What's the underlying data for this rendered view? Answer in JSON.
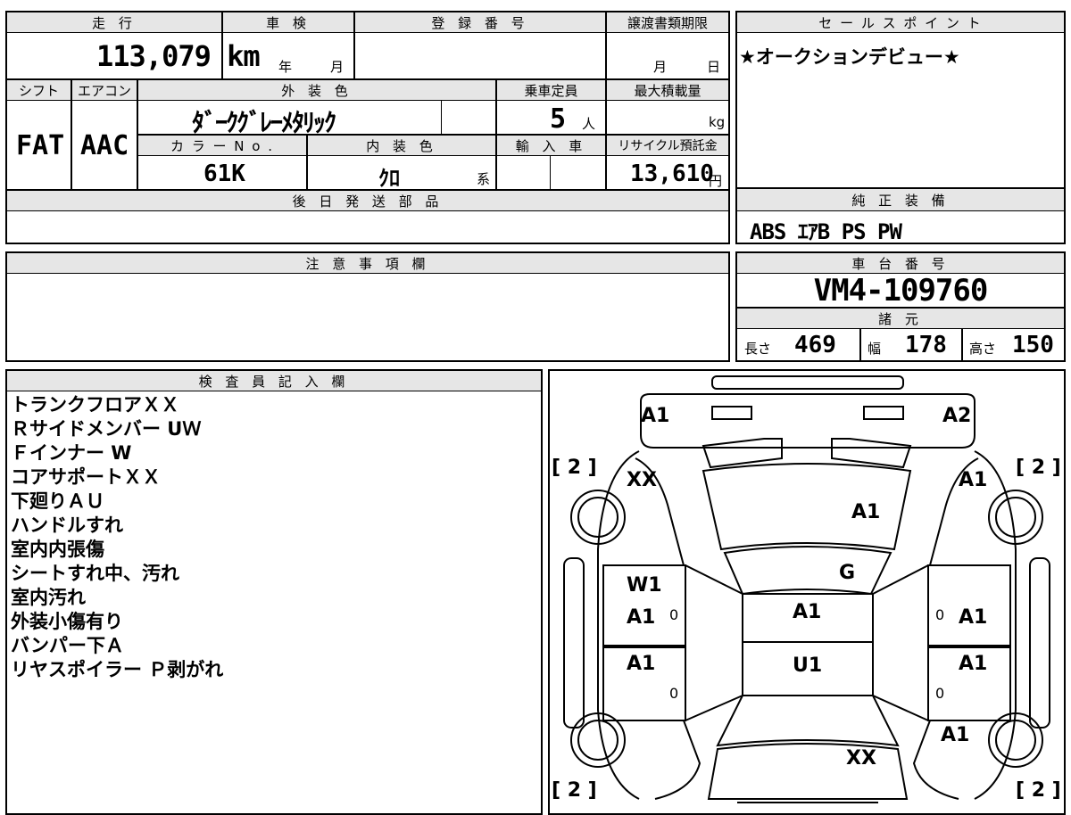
{
  "top_form": {
    "headers": {
      "mileage": "走 行",
      "inspection": "車 検",
      "registration": "登 録 番 号",
      "transfer_deadline": "譲渡書類期限",
      "shift": "シフト",
      "aircon": "エアコン",
      "exterior_color": "外 装 色",
      "capacity": "乗車定員",
      "max_load": "最大積載量",
      "color_no": "カ ラ ー N o .",
      "interior_color": "内 装 色",
      "import": "輸 入 車",
      "recycle": "リサイクル預託金",
      "later_parts": "後 日 発 送 部 品"
    },
    "mileage_value": "113,079 km",
    "inspection_year_unit": "年",
    "inspection_month_unit": "月",
    "transfer_month_unit": "月",
    "transfer_day_unit": "日",
    "shift_value": "FAT",
    "aircon_value": "AAC",
    "exterior_color_value": "ﾀﾞｰｸｸﾞﾚｰﾒﾀﾘｯｸ",
    "capacity_value": "5",
    "capacity_unit": "人",
    "max_load_unit": "kg",
    "color_no_value": "61K",
    "interior_color_value": "ｸﾛ",
    "interior_color_suffix": "系",
    "recycle_value": "13,610",
    "recycle_unit": "円"
  },
  "sales_point": {
    "header": "セ ー ル ス ポ イ ン ト",
    "text": "★オークションデビュー★"
  },
  "genuine_equipment": {
    "header": "純 正 装 備",
    "text": "ABS ｴｱB PS PW"
  },
  "caution": {
    "header": "注 意 事 項 欄"
  },
  "chassis": {
    "header": "車 台 番 号",
    "number": "VM4-109760",
    "spec_header": "諸 元",
    "length_label": "長さ",
    "length_value": "469",
    "width_label": "幅",
    "width_value": "178",
    "height_label": "高さ",
    "height_value": "150"
  },
  "inspector": {
    "header": "検 査 員 記 入 欄",
    "notes": [
      "トランクフロアＸＸ",
      "Ｒサイドメンバー UＷ",
      "Ｆインナー W",
      "コアサポートＸＸ",
      "下廻りＡＵ",
      "ハンドルすれ",
      "室内内張傷",
      "シートすれ中、汚れ",
      "室内汚れ",
      "外装小傷有り",
      "バンパー下Ａ",
      "リヤスポイラー Ｐ剥がれ"
    ]
  },
  "diagram": {
    "tire_fl": "[ 2 ]",
    "tire_fr": "[ 2 ]",
    "tire_rl": "[ 2 ]",
    "tire_rr": "[ 2 ]",
    "bumper_fl": "A1",
    "bumper_fr": "A2",
    "fender_fl": "XX",
    "fender_fr": "A1",
    "hood": "A1",
    "windshield": "G",
    "door_fl_top": "W1",
    "door_fl": "A1",
    "door_rl": "A1",
    "door_fr": "A1",
    "door_rr": "A1",
    "roof": "A1",
    "roof_rear": "U1",
    "quarter_rr": "A1",
    "trunk": "XX",
    "zero": "0"
  }
}
